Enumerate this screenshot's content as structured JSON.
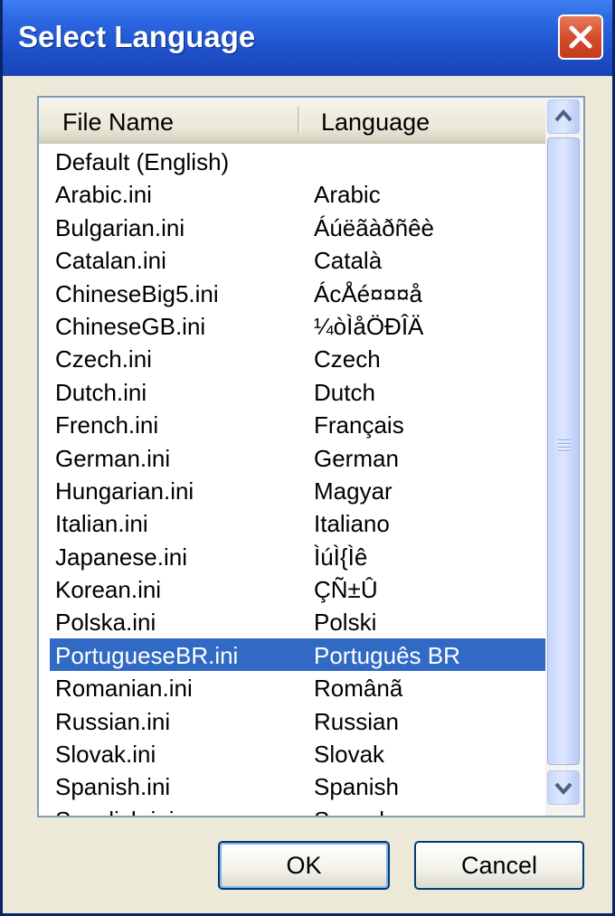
{
  "dialog": {
    "title": "Select Language"
  },
  "columns": {
    "file_name": "File Name",
    "language": "Language"
  },
  "rows": [
    {
      "file": "Default (English)",
      "lang": ""
    },
    {
      "file": "Arabic.ini",
      "lang": "Arabic"
    },
    {
      "file": "Bulgarian.ini",
      "lang": "Áúëãàðñêè"
    },
    {
      "file": "Catalan.ini",
      "lang": "Català"
    },
    {
      "file": "ChineseBig5.ini",
      "lang": "ÁcÅé¤¤¤å"
    },
    {
      "file": "ChineseGB.ini",
      "lang": "¼òÌåÖÐÎÄ"
    },
    {
      "file": "Czech.ini",
      "lang": "Czech"
    },
    {
      "file": "Dutch.ini",
      "lang": "Dutch"
    },
    {
      "file": "French.ini",
      "lang": "Français"
    },
    {
      "file": "German.ini",
      "lang": "German"
    },
    {
      "file": "Hungarian.ini",
      "lang": "Magyar"
    },
    {
      "file": "Italian.ini",
      "lang": "Italiano"
    },
    {
      "file": "Japanese.ini",
      "lang": "ÌúÌ{Ìê"
    },
    {
      "file": "Korean.ini",
      "lang": "ÇÑ±Û"
    },
    {
      "file": "Polska.ini",
      "lang": "Polski"
    },
    {
      "file": "PortugueseBR.ini",
      "lang": "Português BR"
    },
    {
      "file": "Romanian.ini",
      "lang": "Românã"
    },
    {
      "file": "Russian.ini",
      "lang": "Russian"
    },
    {
      "file": "Slovak.ini",
      "lang": "Slovak"
    },
    {
      "file": "Spanish.ini",
      "lang": "Spanish"
    },
    {
      "file": "Swedish.ini",
      "lang": "Svenska"
    }
  ],
  "selected_index": 15,
  "buttons": {
    "ok": "OK",
    "cancel": "Cancel"
  },
  "colors": {
    "titlebar": "#2a66e0",
    "selection": "#316ac5",
    "close": "#d34a2a"
  },
  "icons": {
    "close": "close-icon",
    "scroll_up": "chevron-up-icon",
    "scroll_down": "chevron-down-icon"
  }
}
